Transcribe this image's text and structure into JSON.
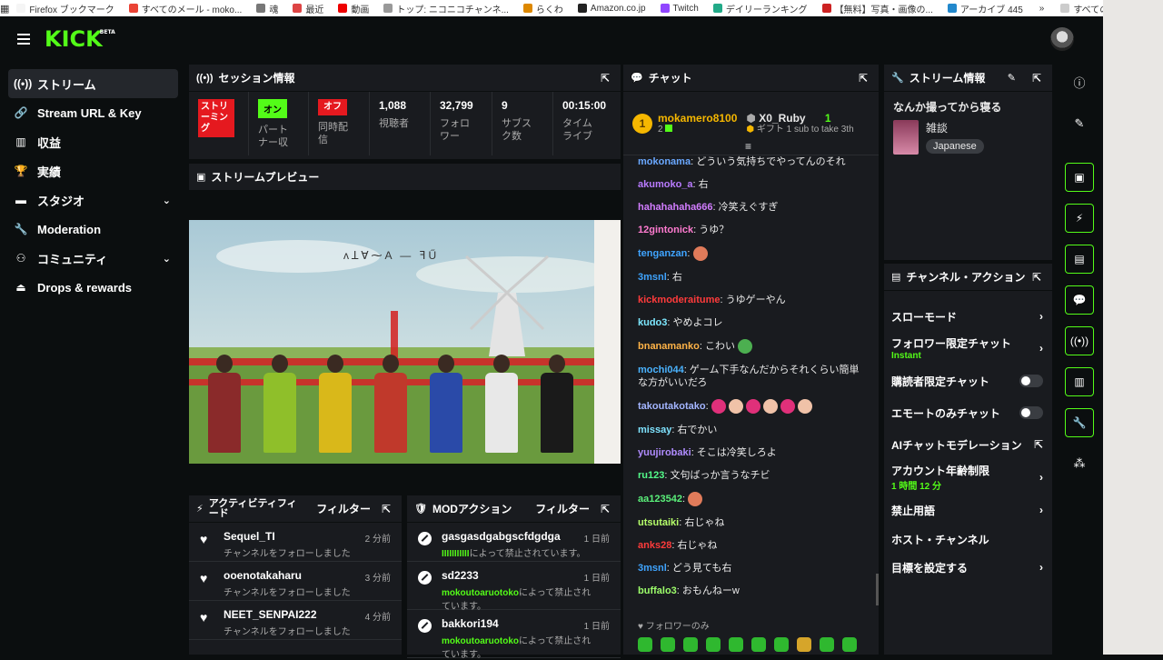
{
  "bookmarks": [
    {
      "label": "Firefox ブックマーク",
      "color": "#f5f5f5"
    },
    {
      "label": "すべてのメール - moko...",
      "color": "#ea4335"
    },
    {
      "label": "魂",
      "color": "#777777"
    },
    {
      "label": "最近",
      "color": "#d44"
    },
    {
      "label": "動画",
      "color": "#e00"
    },
    {
      "label": "トップ: ニコニコチャンネ...",
      "color": "#999"
    },
    {
      "label": "らくわ",
      "color": "#d80"
    },
    {
      "label": "Amazon.co.jp",
      "color": "#222"
    },
    {
      "label": "Twitch",
      "color": "#9146ff"
    },
    {
      "label": "デイリーランキング",
      "color": "#2a8"
    },
    {
      "label": "【無料】写真・画像の...",
      "color": "#c22"
    },
    {
      "label": "アーカイブ 445",
      "color": "#28c"
    }
  ],
  "bookmarks_more": "»",
  "bookmarks_other": "すべてのブックマーク",
  "header": {
    "logo": "KICK",
    "logo_sup": "BETA"
  },
  "sidebar": {
    "items": [
      {
        "label": "ストリーム",
        "icon": "((•))"
      },
      {
        "label": "Stream URL & Key",
        "icon": "🔗"
      },
      {
        "label": "収益",
        "icon": "▥"
      },
      {
        "label": "実績",
        "icon": "🏆"
      },
      {
        "label": "スタジオ",
        "icon": "▬",
        "chevron": "⌄"
      },
      {
        "label": "Moderation",
        "icon": "🔧"
      },
      {
        "label": "コミュニティ",
        "icon": "⚇",
        "chevron": "⌄"
      },
      {
        "label": "Drops & rewards",
        "icon": "⏏"
      }
    ]
  },
  "session": {
    "title": "セッション情報",
    "streaming_badge": "ストリーミング",
    "partner_badge": "オン",
    "partner_label": "パートナー収",
    "simulcast_badge": "オフ",
    "simulcast_label": "同時配信",
    "viewers": "1,088",
    "viewers_label": "視聴者",
    "followers": "32,799",
    "followers_label": "フォロワー",
    "subs": "9",
    "subs_label": "サブスク数",
    "timeline": "00:15:00",
    "timeline_label": "タイムライブ"
  },
  "preview": {
    "title": "ストリームプレビュー",
    "overlay_text": "ᴧꓕⱯ⁓A — ꟻŰ"
  },
  "activity": {
    "title": "アクティビティフィード",
    "filter": "フィルター",
    "items": [
      {
        "name": "Sequel_TI",
        "desc": "チャンネルをフォローしました",
        "time": "2 分前"
      },
      {
        "name": "ooenotakaharu",
        "desc": "チャンネルをフォローしました",
        "time": "3 分前"
      },
      {
        "name": "NEET_SENPAI222",
        "desc": "チャンネルをフォローしました",
        "time": "4 分前"
      }
    ]
  },
  "mod": {
    "title": "MODアクション",
    "filter": "フィルター",
    "items": [
      {
        "name": "gasgasdgabgscfdgdga",
        "by": "IIIIIIIIIII",
        "suffix": "によって禁止されています。",
        "time": "1 日前"
      },
      {
        "name": "sd2233",
        "by": "mokoutoaruotoko",
        "suffix": "によって禁止されています。",
        "time": "1 日前"
      },
      {
        "name": "bakkori194",
        "by": "mokoutoaruotoko",
        "suffix": "によって禁止されています。",
        "time": "1 日前"
      }
    ]
  },
  "chat": {
    "title": "チャット",
    "top1_rank": "1",
    "top1_name": "mokamero8100",
    "top1_count": "2",
    "top2_name": "X0_Ruby",
    "top2_count": "1",
    "top2_desc": "ギフト 1 sub to take 3th",
    "messages": [
      {
        "user": "mokonama",
        "color": "#6aa8ff",
        "text": ": どういう気持ちでやってんのそれ"
      },
      {
        "user": "akumoko_a",
        "color": "#b97bff",
        "text": ": 右"
      },
      {
        "user": "hahahahaha666",
        "color": "#d27dff",
        "text": ": 冷笑えぐすぎ"
      },
      {
        "user": "12gintonick",
        "color": "#ff7bd0",
        "text": ": うゆ？"
      },
      {
        "user": "tenganzan",
        "color": "#3fa4ff",
        "text": ":",
        "emote": "#e07b5a"
      },
      {
        "user": "3msnl",
        "color": "#3fa4ff",
        "text": ": 右"
      },
      {
        "user": "kickmoderaitume",
        "color": "#ff3b3b",
        "text": ": うゆゲーやん"
      },
      {
        "user": "kudo3",
        "color": "#7de8ff",
        "text": ": やめよコレ"
      },
      {
        "user": "bnanamanko",
        "color": "#ffb347",
        "text": ": こわい",
        "emote": "#4caf50"
      },
      {
        "user": "mochi044",
        "color": "#4ab3ff",
        "text": ": ゲーム下手なんだからそれくらい簡単な方がいいだろ"
      },
      {
        "user": "takoutakotako",
        "color": "#a3b5ff",
        "text": ":",
        "emotes": 6
      },
      {
        "user": "missay",
        "color": "#7fe3ff",
        "text": ": 右でかい"
      },
      {
        "user": "yuujirobaki",
        "color": "#b08cff",
        "text": ": そこは冷笑しろよ"
      },
      {
        "user": "ru123",
        "color": "#53fc8a",
        "text": ": 文句ばっか言うなチビ"
      },
      {
        "user": "aa123542",
        "color": "#5af07a",
        "text": ":",
        "emote": "#e07b5a"
      },
      {
        "user": "utsutaiki",
        "color": "#b6ff6b",
        "text": ": 右じゃね"
      },
      {
        "user": "anks28",
        "color": "#ff3b3b",
        "text": ": 右じゃね"
      },
      {
        "user": "3msnl",
        "color": "#3fa4ff",
        "text": ": どう見ても右"
      },
      {
        "user": "buffalo3",
        "color": "#9dff6b",
        "text": ": おもんねーw"
      }
    ],
    "followers_only": "フォロワーのみ"
  },
  "stream_info": {
    "title": "ストリーム情報",
    "stream_title": "なんか撮ってから寝る",
    "category": "雑談",
    "language": "Japanese"
  },
  "channel_actions": {
    "title": "チャンネル・アクション",
    "slow_mode": "スローモード",
    "followers_only": "フォロワー限定チャット",
    "followers_only_sub": "Instant",
    "subs_only": "購読者限定チャット",
    "emote_only": "エモートのみチャット",
    "ai_mod": "AIチャットモデレーション",
    "account_age": "アカウント年齢制限",
    "account_age_sub": "1 時間 12 分",
    "banned_words": "禁止用語",
    "host_channel": "ホスト・チャンネル",
    "set_goal": "目標を設定する"
  },
  "colors": {
    "accent": "#53fc18",
    "panel": "#191b1f",
    "bg": "#0b0e0f",
    "red": "#e5191f"
  }
}
